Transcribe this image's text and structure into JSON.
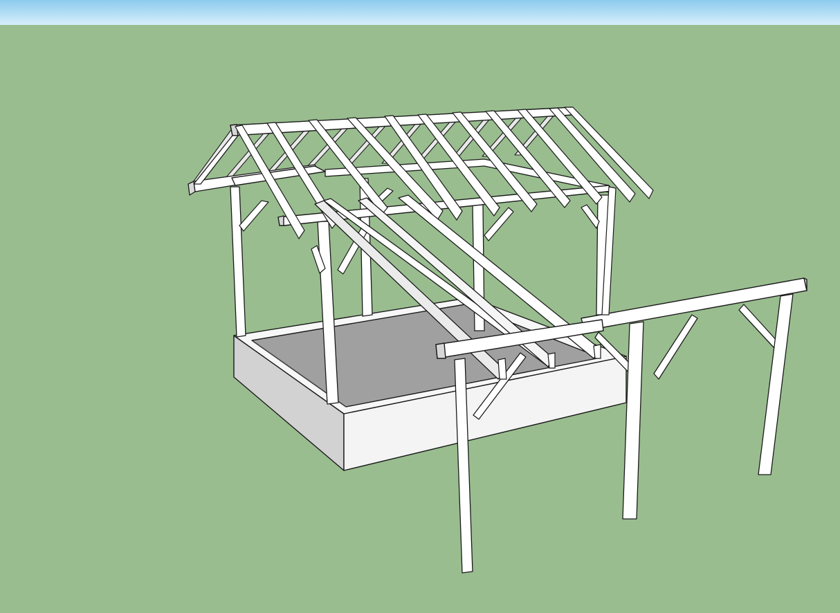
{
  "viewport": {
    "sky_top_color": "#8ccbee",
    "sky_bottom_color": "#d7eefb",
    "ground_color": "#99bd8f"
  },
  "model": {
    "subject": "timber-frame-pavilion",
    "timber_color": "#ffffff",
    "side_face_color": "#d4d4d4",
    "edge_color": "#1a1a1a",
    "floor_color": "#a0a0a0",
    "foundation_color": "#f2f2f2"
  }
}
